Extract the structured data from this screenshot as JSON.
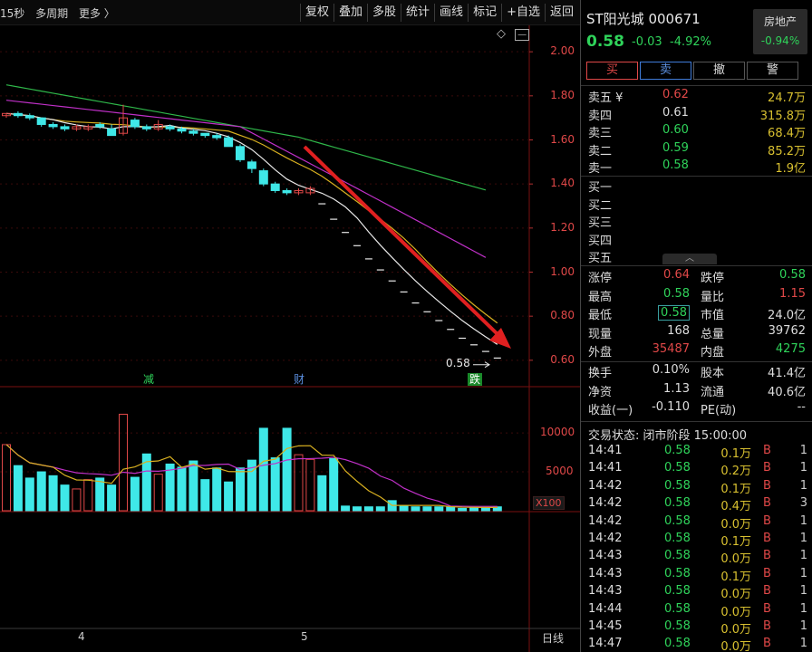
{
  "toolbar": {
    "period": "15秒",
    "multi": "多周期",
    "more": "更多 〉",
    "buttons": [
      "复权",
      "叠加",
      "多股",
      "统计",
      "画线",
      "标记",
      "+自选",
      "返回"
    ]
  },
  "stock": {
    "name": "ST阳光城",
    "code": "000671",
    "price": "0.58",
    "change": "-0.03",
    "pct": "-4.92%",
    "sector_name": "房地产",
    "sector_pct": "-0.94%"
  },
  "trade": {
    "buy": "买",
    "sell": "卖",
    "cancel": "撤",
    "alarm": "警"
  },
  "orderbook": {
    "asks": [
      {
        "label": "卖五 ¥",
        "price": "0.62",
        "vol": "24.7万",
        "color": "red"
      },
      {
        "label": "卖四",
        "price": "0.61",
        "vol": "315.8万",
        "color": "white"
      },
      {
        "label": "卖三",
        "price": "0.60",
        "vol": "68.4万",
        "color": "green"
      },
      {
        "label": "卖二",
        "price": "0.59",
        "vol": "85.2万",
        "color": "green"
      },
      {
        "label": "卖一",
        "price": "0.58",
        "vol": "1.9亿",
        "color": "green"
      }
    ],
    "bids": [
      {
        "label": "买一"
      },
      {
        "label": "买二"
      },
      {
        "label": "买三"
      },
      {
        "label": "买四"
      },
      {
        "label": "买五"
      }
    ]
  },
  "stats": [
    {
      "k1": "涨停",
      "v1": "0.64",
      "c1": "red",
      "k2": "跌停",
      "v2": "0.58",
      "c2": "green"
    },
    {
      "k1": "最高",
      "v1": "0.58",
      "c1": "green",
      "k2": "量比",
      "v2": "1.15",
      "c2": "red"
    },
    {
      "k1": "最低",
      "v1": "0.58",
      "c1": "green boxed",
      "k2": "市值",
      "v2": "24.0亿",
      "c2": "white"
    },
    {
      "k1": "现量",
      "v1": "168",
      "c1": "white",
      "k2": "总量",
      "v2": "39762",
      "c2": "white"
    },
    {
      "k1": "外盘",
      "v1": "35487",
      "c1": "red",
      "k2": "内盘",
      "v2": "4275",
      "c2": "green"
    }
  ],
  "stats2": [
    {
      "k1": "换手",
      "v1": "0.10%",
      "c1": "white",
      "k2": "股本",
      "v2": "41.4亿",
      "c2": "white"
    },
    {
      "k1": "净资",
      "v1": "1.13",
      "c1": "white",
      "k2": "流通",
      "v2": "40.6亿",
      "c2": "white"
    },
    {
      "k1": "收益(一)",
      "v1": "-0.110",
      "c1": "white",
      "k2": "PE(动)",
      "v2": "--",
      "c2": "white"
    }
  ],
  "status": "交易状态: 闭市阶段 15:00:00",
  "ticks": [
    {
      "t": "14:41",
      "p": "0.58",
      "v": "0.1万",
      "bs": "B",
      "n": "1"
    },
    {
      "t": "14:41",
      "p": "0.58",
      "v": "0.2万",
      "bs": "B",
      "n": "1"
    },
    {
      "t": "14:42",
      "p": "0.58",
      "v": "0.1万",
      "bs": "B",
      "n": "1"
    },
    {
      "t": "14:42",
      "p": "0.58",
      "v": "0.4万",
      "bs": "B",
      "n": "3"
    },
    {
      "t": "14:42",
      "p": "0.58",
      "v": "0.0万",
      "bs": "B",
      "n": "1"
    },
    {
      "t": "14:42",
      "p": "0.58",
      "v": "0.1万",
      "bs": "B",
      "n": "1"
    },
    {
      "t": "14:43",
      "p": "0.58",
      "v": "0.0万",
      "bs": "B",
      "n": "1"
    },
    {
      "t": "14:43",
      "p": "0.58",
      "v": "0.1万",
      "bs": "B",
      "n": "1"
    },
    {
      "t": "14:43",
      "p": "0.58",
      "v": "0.0万",
      "bs": "B",
      "n": "1"
    },
    {
      "t": "14:44",
      "p": "0.58",
      "v": "0.0万",
      "bs": "B",
      "n": "1"
    },
    {
      "t": "14:45",
      "p": "0.58",
      "v": "0.0万",
      "bs": "B",
      "n": "1"
    },
    {
      "t": "14:47",
      "p": "0.58",
      "v": "0.0万",
      "bs": "B",
      "n": "1"
    }
  ],
  "chart_data": {
    "type": "candlestick",
    "y_ticks": [
      "2.00",
      "1.80",
      "1.60",
      "1.40",
      "1.20",
      "1.00",
      "0.80",
      "0.60"
    ],
    "ylim": [
      0.55,
      2.05
    ],
    "vol_ticks": [
      "10000",
      "5000"
    ],
    "vol_unit": "X100",
    "x_labels": [
      "4",
      "5"
    ],
    "period_label": "日线",
    "last_price_label": "0.58",
    "events": [
      {
        "label": "减",
        "color": "#2fd35a"
      },
      {
        "label": "财",
        "color": "#5b8fe0"
      },
      {
        "label": "跌",
        "color": "#2fd35a"
      }
    ],
    "candles": [
      [
        1.71,
        1.72,
        1.7,
        1.72
      ],
      [
        1.72,
        1.73,
        1.7,
        1.71
      ],
      [
        1.71,
        1.72,
        1.69,
        1.7
      ],
      [
        1.7,
        1.7,
        1.66,
        1.67
      ],
      [
        1.67,
        1.68,
        1.65,
        1.66
      ],
      [
        1.66,
        1.67,
        1.64,
        1.65
      ],
      [
        1.65,
        1.67,
        1.64,
        1.66
      ],
      [
        1.65,
        1.67,
        1.64,
        1.66
      ],
      [
        1.67,
        1.68,
        1.65,
        1.66
      ],
      [
        1.65,
        1.67,
        1.62,
        1.62
      ],
      [
        1.63,
        1.76,
        1.62,
        1.7
      ],
      [
        1.69,
        1.7,
        1.65,
        1.66
      ],
      [
        1.66,
        1.67,
        1.64,
        1.65
      ],
      [
        1.65,
        1.69,
        1.64,
        1.67
      ],
      [
        1.66,
        1.67,
        1.64,
        1.65
      ],
      [
        1.65,
        1.66,
        1.63,
        1.64
      ],
      [
        1.64,
        1.65,
        1.62,
        1.63
      ],
      [
        1.63,
        1.63,
        1.61,
        1.62
      ],
      [
        1.62,
        1.63,
        1.6,
        1.61
      ],
      [
        1.61,
        1.62,
        1.57,
        1.57
      ],
      [
        1.57,
        1.58,
        1.5,
        1.51
      ],
      [
        1.5,
        1.51,
        1.45,
        1.47
      ],
      [
        1.46,
        1.47,
        1.39,
        1.4
      ],
      [
        1.4,
        1.41,
        1.36,
        1.37
      ],
      [
        1.37,
        1.38,
        1.35,
        1.36
      ],
      [
        1.36,
        1.38,
        1.35,
        1.37
      ],
      [
        1.36,
        1.39,
        1.35,
        1.38
      ],
      [
        1.31,
        1.31,
        1.31,
        1.31
      ],
      [
        1.24,
        1.24,
        1.24,
        1.24
      ],
      [
        1.18,
        1.18,
        1.18,
        1.18
      ],
      [
        1.12,
        1.12,
        1.12,
        1.12
      ],
      [
        1.06,
        1.06,
        1.06,
        1.06
      ],
      [
        1.01,
        1.01,
        1.01,
        1.01
      ],
      [
        0.96,
        0.96,
        0.96,
        0.96
      ],
      [
        0.91,
        0.91,
        0.91,
        0.91
      ],
      [
        0.86,
        0.86,
        0.86,
        0.86
      ],
      [
        0.82,
        0.82,
        0.82,
        0.82
      ],
      [
        0.78,
        0.78,
        0.78,
        0.78
      ],
      [
        0.74,
        0.74,
        0.74,
        0.74
      ],
      [
        0.7,
        0.7,
        0.7,
        0.7
      ],
      [
        0.67,
        0.67,
        0.67,
        0.67
      ],
      [
        0.64,
        0.64,
        0.64,
        0.64
      ],
      [
        0.61,
        0.61,
        0.61,
        0.61
      ]
    ],
    "volumes": [
      8500,
      5800,
      4200,
      5000,
      4500,
      3300,
      2800,
      4000,
      4200,
      3300,
      12400,
      4300,
      7300,
      4700,
      6000,
      5600,
      6400,
      4000,
      5500,
      3700,
      5500,
      6500,
      10600,
      6800,
      10600,
      7200,
      6600,
      4500,
      6700,
      600,
      500,
      500,
      500,
      1300,
      600,
      500,
      500,
      500,
      500,
      300,
      400,
      400,
      500
    ],
    "vol_ylim": [
      0,
      13500
    ]
  }
}
